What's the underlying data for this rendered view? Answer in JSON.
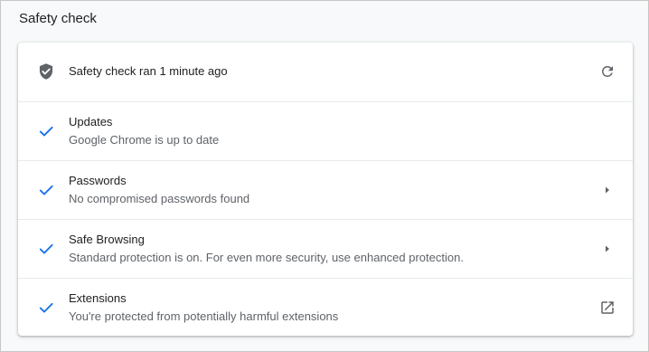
{
  "section": {
    "title": "Safety check"
  },
  "status": {
    "label": "Safety check ran 1 minute ago",
    "icon": "shield-check-icon",
    "action_icon": "refresh-icon"
  },
  "items": [
    {
      "title": "Updates",
      "subtitle": "Google Chrome is up to date",
      "icon": "checkmark-icon",
      "trailing": ""
    },
    {
      "title": "Passwords",
      "subtitle": "No compromised passwords found",
      "icon": "checkmark-icon",
      "trailing": "arrow-right-icon"
    },
    {
      "title": "Safe Browsing",
      "subtitle": "Standard protection is on. For even more security, use enhanced protection.",
      "icon": "checkmark-icon",
      "trailing": "arrow-right-icon"
    },
    {
      "title": "Extensions",
      "subtitle": "You're protected from potentially harmful extensions",
      "icon": "checkmark-icon",
      "trailing": "open-in-new-icon"
    }
  ],
  "colors": {
    "check": "#1a73e8",
    "shield": "#5f6368",
    "secondary_text": "#5f6368"
  }
}
